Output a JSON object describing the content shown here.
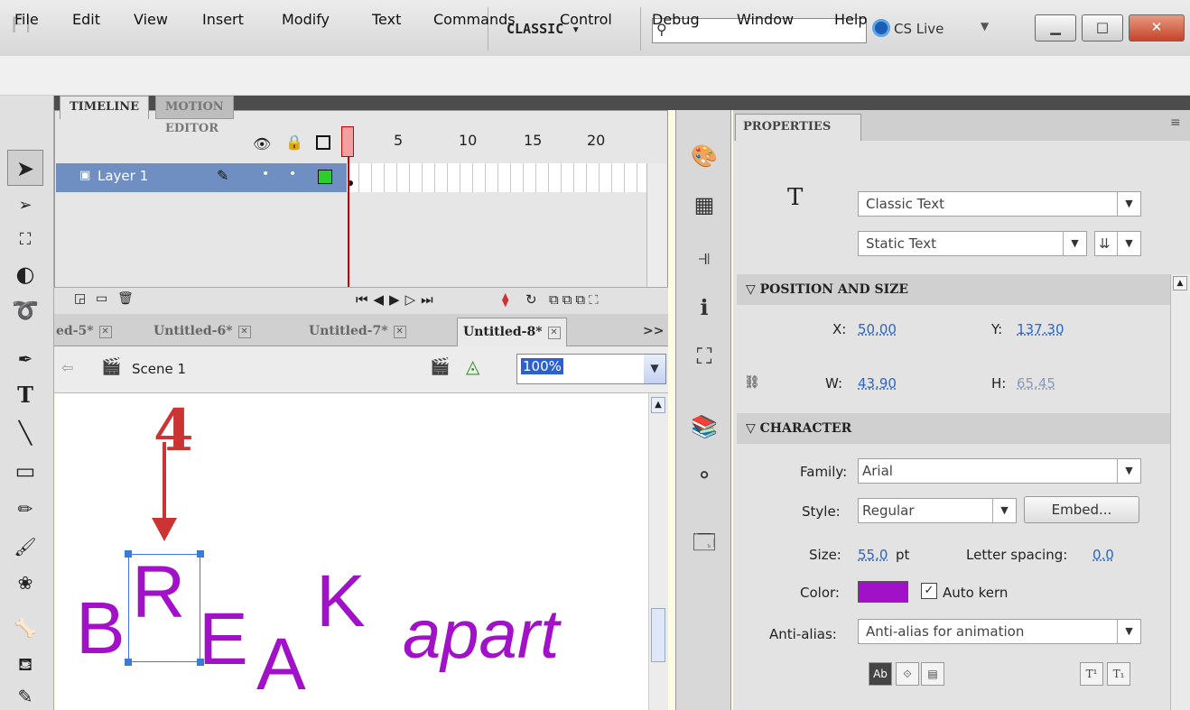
{
  "app": {
    "logo": "Fl",
    "workspace": "CLASSIC ▾",
    "cs_live": "CS Live"
  },
  "menu": [
    "File",
    "Edit",
    "View",
    "Insert",
    "Modify",
    "Text",
    "Commands",
    "Control",
    "Debug",
    "Window",
    "Help"
  ],
  "timeline": {
    "tabs": [
      "TIMELINE",
      "MOTION EDITOR"
    ],
    "layer_name": "Layer 1",
    "ruler": [
      "l",
      "5",
      "10",
      "15",
      "20"
    ]
  },
  "documents": {
    "tabs": [
      "ed-5*",
      "Untitled-6*",
      "Untitled-7*",
      "Untitled-8*"
    ],
    "overflow": ">>",
    "scene": "Scene 1",
    "zoom": "100%"
  },
  "stage": {
    "annotation": "4",
    "letters": [
      "B",
      "R",
      "E",
      "A",
      "K"
    ],
    "word": "apart"
  },
  "properties": {
    "tab": "PROPERTIES",
    "text_engine": "Classic Text",
    "text_type": "Static Text",
    "section_position": "POSITION AND SIZE",
    "x_label": "X:",
    "x": "50.00",
    "y_label": "Y:",
    "y": "137.30",
    "w_label": "W:",
    "w": "43.90",
    "h_label": "H:",
    "h": "65.45",
    "section_character": "CHARACTER",
    "family_label": "Family:",
    "family": "Arial",
    "style_label": "Style:",
    "style": "Regular",
    "embed": "Embed...",
    "size_label": "Size:",
    "size": "55.0",
    "size_unit": "pt",
    "letter_spacing_label": "Letter spacing:",
    "letter_spacing": "0.0",
    "color_label": "Color:",
    "color": "#a011c8",
    "auto_kern": "Auto kern",
    "antialias_label": "Anti-alias:",
    "antialias": "Anti-alias for animation"
  }
}
